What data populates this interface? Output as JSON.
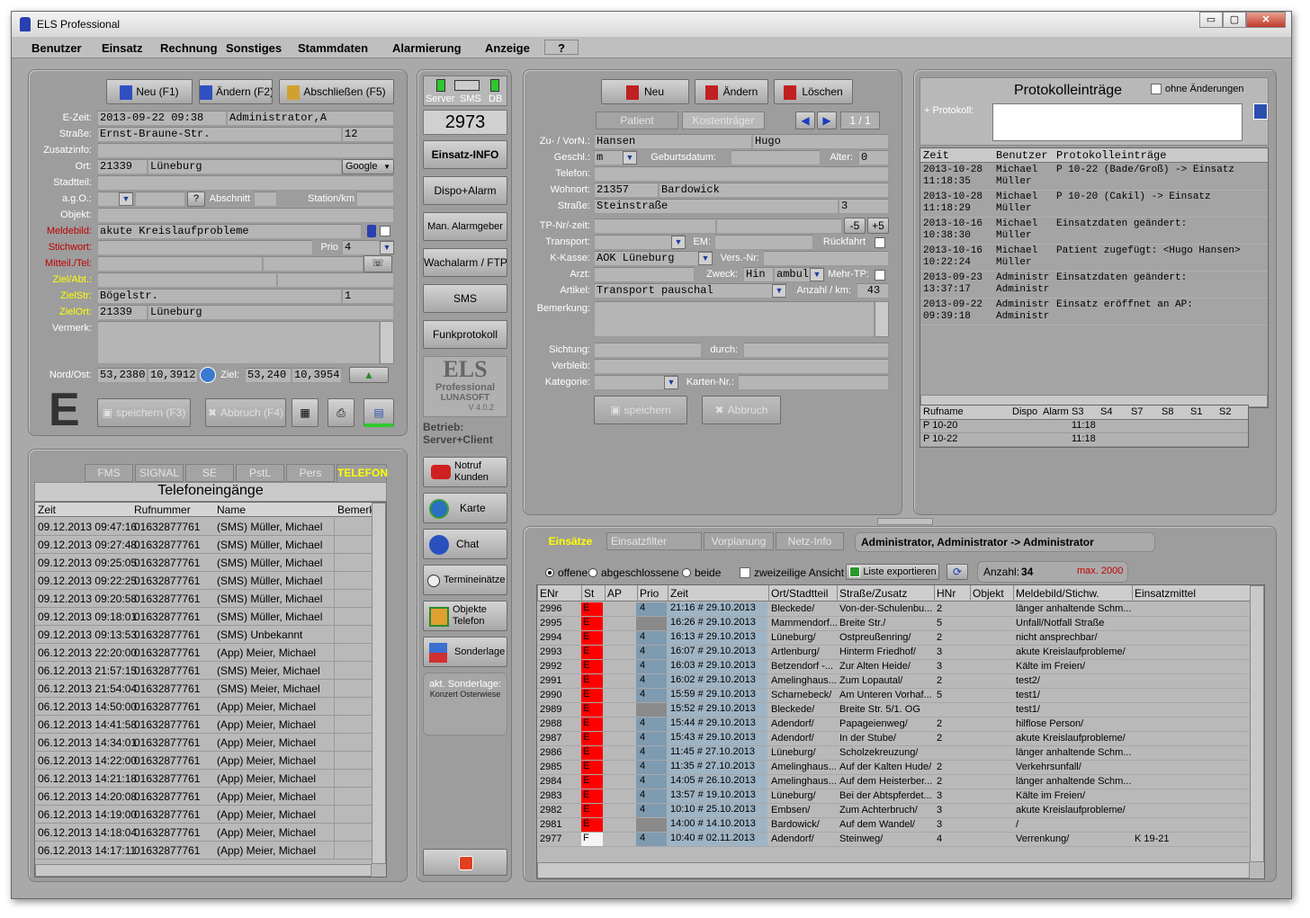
{
  "title": "ELS Professional",
  "window_buttons": {
    "minimize": "▭",
    "maximize": "▢",
    "close": "✕"
  },
  "menu": [
    "Benutzer",
    "Einsatz",
    "Rechnung",
    "Sonstiges",
    "Stammdaten",
    "Alarmierung",
    "Anzeige",
    "?"
  ],
  "einsatz": {
    "buttons": {
      "neu": "Neu (F1)",
      "aendern": "Ändern (F2)",
      "abschliessen": "Abschließen (F5)",
      "speichern": "speichern (F3)",
      "abbruch": "Abbruch (F4)"
    },
    "labels": {
      "ezeit": "E-Zeit:",
      "strasse": "Straße:",
      "zusatzinfo": "Zusatzinfo:",
      "ort": "Ort:",
      "stadtteil": "Stadtteil:",
      "ago": "a.g.O.:",
      "objekt": "Objekt:",
      "meldebild": "Meldebild:",
      "stichwort": "Stichwort:",
      "mitteil": "Mitteil./Tel:",
      "ziel": "Ziel/Abt.:",
      "zielstr": "ZielStr:",
      "zielort": "ZielOrt:",
      "vermerk": "Vermerk:",
      "nordost": "Nord/Ost:",
      "prio": "Prio",
      "abschnitt": "Abschnitt",
      "station": "Station/km",
      "zielcoord": "Ziel:",
      "qmark": "?"
    },
    "values": {
      "ezeit": "2013-09-22 09:38",
      "admin": "Administrator,A",
      "strasse": "Ernst-Braune-Str.",
      "hausnr": "12",
      "plz": "21339",
      "ort": "Lüneburg",
      "google": "Google",
      "meldebild": "akute Kreislaufprobleme",
      "prio": "4",
      "zielstr": "Bögelstr.",
      "zielnr": "1",
      "zielplz": "21339",
      "zielort": "Lüneburg",
      "nord": "53,2380",
      "ost": "10,3912",
      "zielnord": "53,240",
      "zielost": "10,3954"
    },
    "big_letter": "E"
  },
  "telefon": {
    "tabs": [
      "FMS",
      "SIGNAL",
      "SE",
      "PstL",
      "Pers",
      "TELEFON"
    ],
    "title": "Telefoneingänge",
    "columns": [
      "Zeit",
      "Rufnummer",
      "Name",
      "Bemerk"
    ],
    "rows": [
      [
        "09.12.2013 09:47:16",
        "01632877761",
        "(SMS) Müller, Michael"
      ],
      [
        "09.12.2013 09:27:48",
        "01632877761",
        "(SMS) Müller, Michael"
      ],
      [
        "09.12.2013 09:25:05",
        "01632877761",
        "(SMS) Müller, Michael"
      ],
      [
        "09.12.2013 09:22:25",
        "01632877761",
        "(SMS) Müller, Michael"
      ],
      [
        "09.12.2013 09:20:58",
        "01632877761",
        "(SMS) Müller, Michael"
      ],
      [
        "09.12.2013 09:18:01",
        "01632877761",
        "(SMS) Müller, Michael"
      ],
      [
        "09.12.2013 09:13:53",
        "01632877761",
        "(SMS) Unbekannt"
      ],
      [
        "06.12.2013 22:20:00",
        "01632877761",
        "(App) Meier, Michael"
      ],
      [
        "06.12.2013 21:57:15",
        "01632877761",
        "(SMS) Meier, Michael"
      ],
      [
        "06.12.2013 21:54:04",
        "01632877761",
        "(SMS) Meier, Michael"
      ],
      [
        "06.12.2013 14:50:00",
        "01632877761",
        "(App) Meier, Michael"
      ],
      [
        "06.12.2013 14:41:58",
        "01632877761",
        "(App) Meier, Michael"
      ],
      [
        "06.12.2013 14:34:01",
        "01632877761",
        "(App) Meier, Michael"
      ],
      [
        "06.12.2013 14:22:00",
        "01632877761",
        "(App) Meier, Michael"
      ],
      [
        "06.12.2013 14:21:18",
        "01632877761",
        "(App) Meier, Michael"
      ],
      [
        "06.12.2013 14:20:08",
        "01632877761",
        "(App) Meier, Michael"
      ],
      [
        "06.12.2013 14:19:00",
        "01632877761",
        "(App) Meier, Michael"
      ],
      [
        "06.12.2013 14:18:04",
        "01632877761",
        "(App) Meier, Michael"
      ],
      [
        "06.12.2013 14:17:11",
        "01632877761",
        "(App) Meier, Michael"
      ]
    ]
  },
  "mid": {
    "status": {
      "server": "Server",
      "sms": "SMS",
      "db": "DB"
    },
    "number": "2973",
    "buttons": [
      "Einsatz-INFO",
      "Dispo+Alarm",
      "Man. Alarmgeber",
      "Wachalarm / FTP",
      "SMS",
      "Funkprotokoll"
    ],
    "logo": {
      "line1": "ELS",
      "line2": "Professional",
      "line3": "LUNASOFT",
      "version": "V 4.0.2"
    },
    "betrieb": "Betrieb:",
    "betrieb2": "Server+Client",
    "icon_buttons": [
      {
        "label1": "Notruf",
        "label2": "Kunden"
      },
      {
        "label1": "Karte"
      },
      {
        "label1": "Chat"
      },
      {
        "label1": "Termineinätze"
      },
      {
        "label1": "Objekte",
        "label2": "Telefon"
      },
      {
        "label1": "Sonderlage"
      }
    ],
    "sonderlage": "akt. Sonderlage:",
    "sonderlage_val": "Konzert Osterwiese"
  },
  "patient": {
    "buttons": {
      "neu": "Neu",
      "aendern": "Ändern",
      "loeschen": "Löschen",
      "speichern": "speichern",
      "abbruch": "Abbruch"
    },
    "tabs": [
      "Patient",
      "Kostenträger"
    ],
    "pager": "1 / 1",
    "labels": {
      "name": "Zu- / VorN.:",
      "geschl": "Geschl.:",
      "geburt": "Geburtsdatum:",
      "alter": "Alter:",
      "telefon": "Telefon:",
      "wohnort": "Wohnort:",
      "strasse": "Straße:",
      "tpnr": "TP-Nr/-zeit:",
      "transport": "Transport:",
      "em": "EM:",
      "rueckfahrt": "Rückfahrt",
      "kkasse": "K-Kasse:",
      "versnr": "Vers.-Nr:",
      "arzt": "Arzt:",
      "zweck": "Zweck:",
      "mehrtp": "Mehr-TP:",
      "artikel": "Artikel:",
      "anzahl": "Anzahl / km:",
      "bemerkung": "Bemerkung:",
      "sichtung": "Sichtung:",
      "durch": "durch:",
      "verbleib": "Verbleib:",
      "kategorie": "Kategorie:",
      "kartennr": "Karten-Nr.:"
    },
    "values": {
      "name": "Hansen",
      "vorname": "Hugo",
      "geschl": "m",
      "alter": "0",
      "plz": "21357",
      "ort": "Bardowick",
      "strasse": "Steinstraße",
      "hausnr": "3",
      "minus5": "-5",
      "plus5": "+5",
      "kkasse": "AOK Lüneburg",
      "zweck1": "Hin",
      "zweck2": "ambul",
      "artikel": "Transport pauschal",
      "anzahl": "43"
    }
  },
  "protokoll": {
    "title": "Protokolleinträge",
    "ohne": "ohne Änderungen",
    "plus": "+ Protokoll:",
    "columns": [
      "Zeit",
      "Benutzer",
      "Protokolleinträge"
    ],
    "rows": [
      {
        "zeit": [
          "2013-10-28",
          "11:18:35"
        ],
        "ben": [
          "Michael",
          "Müller"
        ],
        "txt": "P 10-22 (Bade/Groß) -> Einsatz"
      },
      {
        "zeit": [
          "2013-10-28",
          "11:18:29"
        ],
        "ben": [
          "Michael",
          "Müller"
        ],
        "txt": "P 10-20 (Cakil) -> Einsatz"
      },
      {
        "zeit": [
          "2013-10-16",
          "10:38:30"
        ],
        "ben": [
          "Michael",
          "Müller"
        ],
        "txt": "Einsatzdaten geändert:"
      },
      {
        "zeit": [
          "2013-10-16",
          "10:22:24"
        ],
        "ben": [
          "Michael",
          "Müller"
        ],
        "txt": "Patient zugefügt: <Hugo Hansen>"
      },
      {
        "zeit": [
          "2013-09-23",
          "13:37:17"
        ],
        "ben": [
          "Administr",
          "Administr"
        ],
        "txt": "Einsatzdaten geändert:"
      },
      {
        "zeit": [
          "2013-09-22",
          "09:39:18"
        ],
        "ben": [
          "Administr",
          "Administr"
        ],
        "txt": "Einsatz eröffnet an AP:"
      }
    ],
    "ruf_columns": [
      "Rufname",
      "Dispo",
      "Alarm",
      "S3",
      "S4",
      "S7",
      "S8",
      "S1",
      "S2"
    ],
    "ruf_rows": [
      [
        "P 10-20",
        "11:18"
      ],
      [
        "P 10-22",
        "11:18"
      ]
    ]
  },
  "einsaetze": {
    "tabs": [
      "Einsätze",
      "Einsatzfilter",
      "Vorplanung",
      "Netz-Info"
    ],
    "user_text": "Administrator, Administrator -> Administrator",
    "filters": {
      "offene": "offene",
      "abgeschlossene": "abgeschlossene",
      "beide": "beide",
      "zweizeilig": "zweizeilige Ansicht",
      "export": "Liste exportieren",
      "anzahl_label": "Anzahl:",
      "anzahl": "34",
      "max": "max. 2000"
    },
    "columns": [
      "ENr",
      "St",
      "AP",
      "Prio",
      "Zeit",
      "Ort/Stadtteil",
      "Straße/Zusatz",
      "HNr",
      "Objekt",
      "Meldebild/Stichw.",
      "Einsatzmittel"
    ],
    "status_colors": {
      "E": "#ff0000",
      "F": "#f4f4f4"
    },
    "rows": [
      [
        "2996",
        "E",
        "",
        "4",
        "21:16 # 29.10.2013",
        "Bleckede/",
        "Von-der-Schulenbu...",
        "2",
        "",
        "länger anhaltende Schm...",
        ""
      ],
      [
        "2995",
        "E",
        "",
        "",
        "16:26 # 29.10.2013",
        "Mammendorf...",
        "Breite Str./",
        "5",
        "",
        "Unfall/Notfall Straße",
        ""
      ],
      [
        "2994",
        "E",
        "",
        "4",
        "16:13 # 29.10.2013",
        "Lüneburg/",
        "Ostpreußenring/",
        "2",
        "",
        "nicht ansprechbar/",
        ""
      ],
      [
        "2993",
        "E",
        "",
        "4",
        "16:07 # 29.10.2013",
        "Artlenburg/",
        "Hinterm Friedhof/",
        "3",
        "",
        "akute Kreislaufprobleme/",
        ""
      ],
      [
        "2992",
        "E",
        "",
        "4",
        "16:03 # 29.10.2013",
        "Betzendorf -...",
        "Zur Alten Heide/",
        "3",
        "",
        "Kälte im Freien/",
        ""
      ],
      [
        "2991",
        "E",
        "",
        "4",
        "16:02 # 29.10.2013",
        "Amelinghaus...",
        "Zum Lopautal/",
        "2",
        "",
        "test2/",
        ""
      ],
      [
        "2990",
        "E",
        "",
        "4",
        "15:59 # 29.10.2013",
        "Scharnebeck/",
        "Am Unteren Vorhaf...",
        "5",
        "",
        "test1/",
        ""
      ],
      [
        "2989",
        "E",
        "",
        "",
        "15:52 # 29.10.2013",
        "Bleckede/",
        "Breite Str. 5/1. OG",
        "",
        "",
        "test1/",
        ""
      ],
      [
        "2988",
        "E",
        "",
        "4",
        "15:44 # 29.10.2013",
        "Adendorf/",
        "Papageienweg/",
        "2",
        "",
        "hilflose Person/",
        ""
      ],
      [
        "2987",
        "E",
        "",
        "4",
        "15:43 # 29.10.2013",
        "Adendorf/",
        "In der Stube/",
        "2",
        "",
        "akute Kreislaufprobleme/",
        ""
      ],
      [
        "2986",
        "E",
        "",
        "4",
        "11:45 # 27.10.2013",
        "Lüneburg/",
        "Scholzekreuzung/",
        "",
        "",
        "länger anhaltende Schm...",
        ""
      ],
      [
        "2985",
        "E",
        "",
        "4",
        "11:35 # 27.10.2013",
        "Amelinghaus...",
        "Auf der Kalten Hude/",
        "2",
        "",
        "Verkehrsunfall/",
        ""
      ],
      [
        "2984",
        "E",
        "",
        "4",
        "14:05 # 26.10.2013",
        "Amelinghaus...",
        "Auf dem Heisterber...",
        "2",
        "",
        "länger anhaltende Schm...",
        ""
      ],
      [
        "2983",
        "E",
        "",
        "4",
        "13:57 # 19.10.2013",
        "Lüneburg/",
        "Bei der Abtspferdet...",
        "3",
        "",
        "Kälte im Freien/",
        ""
      ],
      [
        "2982",
        "E",
        "",
        "4",
        "10:10 # 25.10.2013",
        "Embsen/",
        "Zum Achterbruch/",
        "3",
        "",
        "akute Kreislaufprobleme/",
        ""
      ],
      [
        "2981",
        "E",
        "",
        "",
        "14:00 # 14.10.2013",
        "Bardowick/",
        "Auf dem Wandel/",
        "3",
        "",
        "/",
        ""
      ],
      [
        "2977",
        "F",
        "",
        "4",
        "10:40 # 02.11.2013",
        "Adendorf/",
        "Steinweg/",
        "4",
        "",
        "Verrenkung/",
        "K 19-21"
      ]
    ]
  }
}
